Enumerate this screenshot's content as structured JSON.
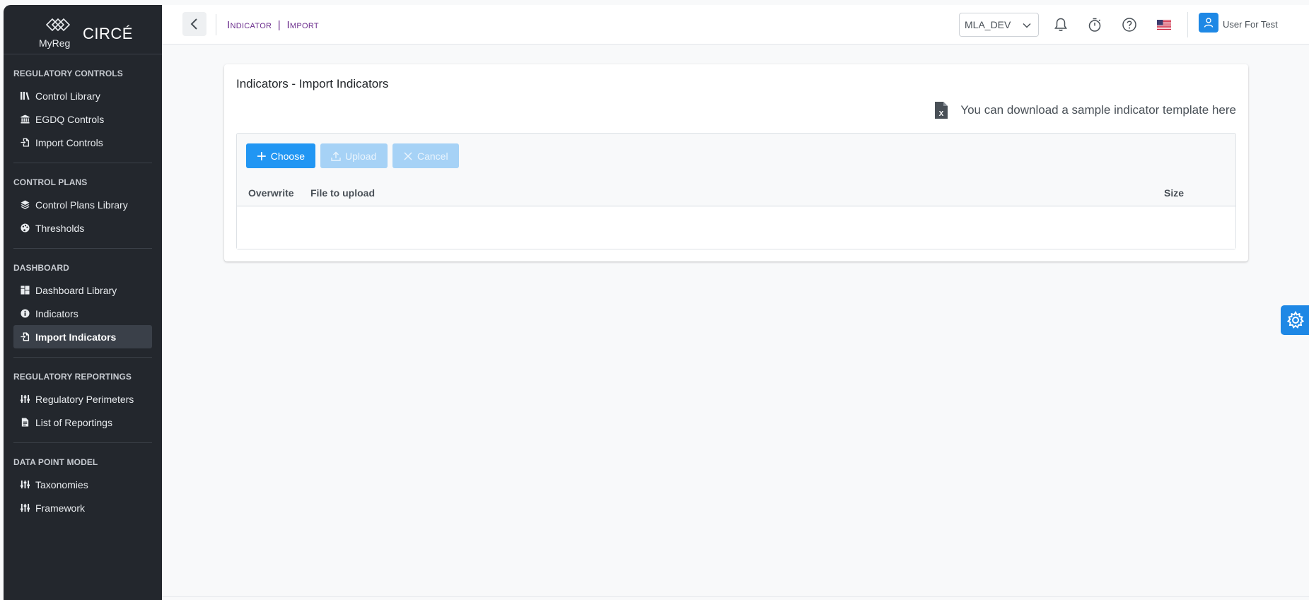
{
  "brand": {
    "sub": "MyReg",
    "name": "CIRCÉ"
  },
  "sidebar": {
    "sections": [
      {
        "title": "REGULATORY CONTROLS",
        "items": [
          {
            "label": "Control Library",
            "icon": "library-icon"
          },
          {
            "label": "EGDQ Controls",
            "icon": "bank-icon"
          },
          {
            "label": "Import Controls",
            "icon": "file-import-icon"
          }
        ]
      },
      {
        "title": "CONTROL PLANS",
        "items": [
          {
            "label": "Control Plans Library",
            "icon": "layers-icon"
          },
          {
            "label": "Thresholds",
            "icon": "palette-icon"
          }
        ]
      },
      {
        "title": "DASHBOARD",
        "items": [
          {
            "label": "Dashboard Library",
            "icon": "grid-icon"
          },
          {
            "label": "Indicators",
            "icon": "info-circle-icon"
          },
          {
            "label": "Import Indicators",
            "icon": "file-import-icon",
            "active": true
          }
        ]
      },
      {
        "title": "REGULATORY REPORTINGS",
        "items": [
          {
            "label": "Regulatory Perimeters",
            "icon": "sliders-icon"
          },
          {
            "label": "List of Reportings",
            "icon": "file-icon"
          }
        ]
      },
      {
        "title": "DATA POINT MODEL",
        "items": [
          {
            "label": "Taxonomies",
            "icon": "sliders-icon"
          },
          {
            "label": "Framework",
            "icon": "sliders-icon"
          }
        ]
      }
    ]
  },
  "header": {
    "breadcrumb_1": "Indicator",
    "breadcrumb_sep": "|",
    "breadcrumb_2": "Import",
    "environment": "MLA_DEV",
    "user": "User For Test"
  },
  "card": {
    "title": "Indicators - Import Indicators",
    "template_link": "You can download a sample indicator template here"
  },
  "uploader": {
    "choose_label": "Choose",
    "upload_label": "Upload",
    "cancel_label": "Cancel",
    "columns": {
      "overwrite": "Overwrite",
      "file": "File to upload",
      "size": "Size"
    }
  },
  "colors": {
    "sidebar_bg": "#23272d",
    "accent": "#2196f3",
    "breadcrumb": "#6b2d8d"
  }
}
